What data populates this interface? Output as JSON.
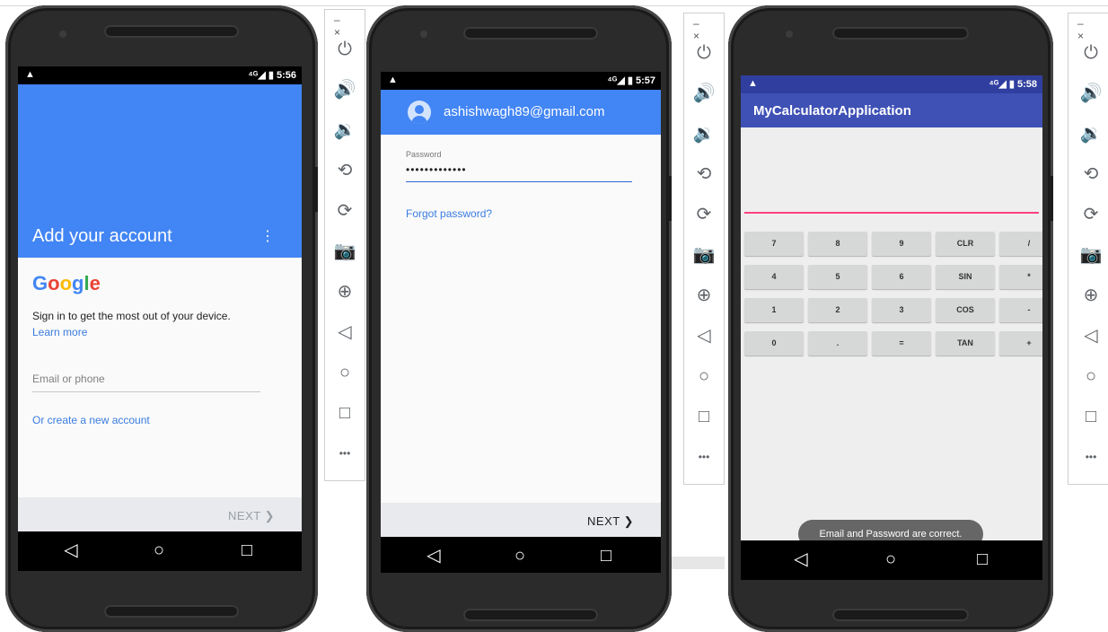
{
  "status": {
    "warning_glyph": "▲",
    "screen1": {
      "signal": "⁴ᴳ◢",
      "battery": "▮",
      "time": "5:56"
    },
    "screen2": {
      "signal": "⁴ᴳ◢",
      "battery": "▮",
      "time": "5:57"
    },
    "screen3": {
      "signal": "⁴ᴳ◢",
      "battery": "▮",
      "time": "5:58"
    }
  },
  "nav": {
    "back": "◁",
    "home": "○",
    "recents": "□"
  },
  "panel": {
    "window_controls": "– ×",
    "icons": [
      "power-icon",
      "volume-up-icon",
      "volume-down-icon",
      "rotate-left-icon",
      "rotate-right-icon",
      "camera-icon",
      "zoom-in-icon",
      "back-icon",
      "home-icon",
      "overview-icon",
      "more-icon"
    ],
    "glyphs": [
      "⏻",
      "🔊",
      "🔉",
      "⟲",
      "⟳",
      "📷",
      "⊕",
      "◁",
      "○",
      "□",
      "•••"
    ]
  },
  "screen1": {
    "hero_title": "Add your account",
    "menu_glyph": "⋮",
    "google_logo": {
      "letters": [
        "G",
        "o",
        "o",
        "g",
        "l",
        "e"
      ],
      "colors": [
        "#4285F4",
        "#EA4335",
        "#FBBC05",
        "#4285F4",
        "#34A853",
        "#EA4335"
      ]
    },
    "sign_in_text": "Sign in to get the most out of your device.",
    "learn_more": "Learn more",
    "email_placeholder": "Email or phone",
    "create_account": "Or create a new account",
    "next_label": "NEXT  ❯"
  },
  "screen2": {
    "email": "ashishwagh89@gmail.com",
    "password_label": "Password",
    "password_value": "•••••••••••••",
    "forgot_password": "Forgot password?",
    "next_label": "NEXT  ❯"
  },
  "screen3": {
    "app_title": "MyCalculatorApplication",
    "keys": [
      [
        "7",
        "8",
        "9",
        "CLR",
        "/"
      ],
      [
        "4",
        "5",
        "6",
        "SIN",
        "*"
      ],
      [
        "1",
        "2",
        "3",
        "COS",
        "-"
      ],
      [
        "0",
        ".",
        "=",
        "TAN",
        "+"
      ]
    ],
    "toast": "Email and Password are correct."
  },
  "colors": {
    "google_blue": "#4285f4",
    "indigo": "#3f51b5",
    "accent_pink": "#ff4081",
    "link_blue": "#3a7ce0"
  }
}
